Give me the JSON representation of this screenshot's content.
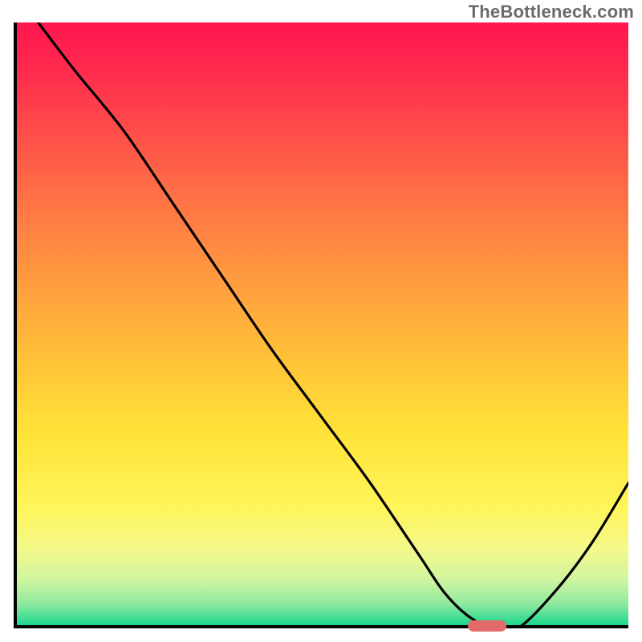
{
  "watermark": "TheBottleneck.com",
  "chart_data": {
    "type": "line",
    "title": "",
    "xlabel": "",
    "ylabel": "",
    "xlim": [
      0,
      100
    ],
    "ylim": [
      0,
      100
    ],
    "grid": false,
    "legend": false,
    "series": [
      {
        "name": "bottleneck-curve",
        "x": [
          4,
          10,
          18,
          26,
          34,
          42,
          50,
          58,
          66,
          70,
          74,
          78,
          82,
          88,
          94,
          100
        ],
        "y": [
          100,
          92,
          82,
          70,
          58,
          46,
          35,
          24,
          12,
          6,
          2,
          0,
          0,
          6,
          14,
          24
        ]
      }
    ],
    "marker": {
      "x": 77,
      "y": 0,
      "label": "optimal-point"
    },
    "gradient_stops": [
      {
        "pos": 0,
        "color": "#ff1650"
      },
      {
        "pos": 50,
        "color": "#ffc338"
      },
      {
        "pos": 85,
        "color": "#fff55a"
      },
      {
        "pos": 100,
        "color": "#13d185"
      }
    ]
  }
}
